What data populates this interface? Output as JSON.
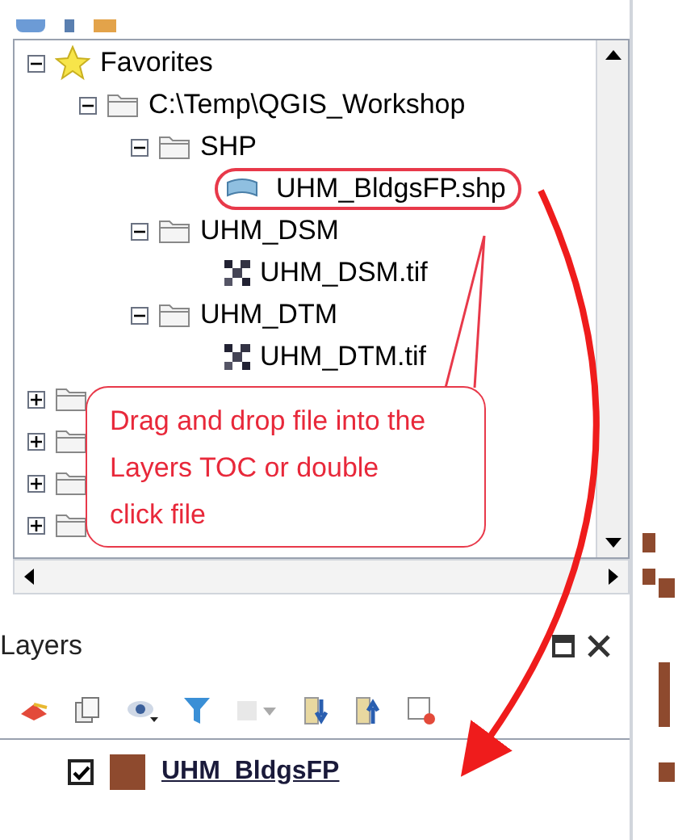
{
  "browser": {
    "tree": [
      {
        "label": "Favorites",
        "kind": "favorites",
        "expanded": true,
        "children": [
          {
            "label": "C:\\Temp\\QGIS_Workshop",
            "kind": "folder",
            "expanded": true,
            "children": [
              {
                "label": "SHP",
                "kind": "folder",
                "expanded": true,
                "children": [
                  {
                    "label": "UHM_BldgsFP.shp",
                    "kind": "vector",
                    "highlighted": true
                  }
                ]
              },
              {
                "label": "UHM_DSM",
                "kind": "folder",
                "expanded": true,
                "children": [
                  {
                    "label": "UHM_DSM.tif",
                    "kind": "raster",
                    "highlighted": false
                  }
                ]
              },
              {
                "label": "UHM_DTM",
                "kind": "folder",
                "expanded": true,
                "children": [
                  {
                    "label": "UHM_DTM.tif",
                    "kind": "raster",
                    "highlighted": false
                  }
                ]
              }
            ]
          }
        ]
      },
      {
        "kind": "folder",
        "expanded": false
      },
      {
        "kind": "folder",
        "expanded": false
      },
      {
        "kind": "folder",
        "expanded": false
      },
      {
        "kind": "folder",
        "expanded": false
      }
    ]
  },
  "callout": {
    "text": "Drag and drop file into the Layers TOC or double click file"
  },
  "layers_panel": {
    "title": "Layers",
    "layers": [
      {
        "name": "UHM_BldgsFP",
        "checked": true,
        "color": "#8e4a2e"
      }
    ]
  }
}
